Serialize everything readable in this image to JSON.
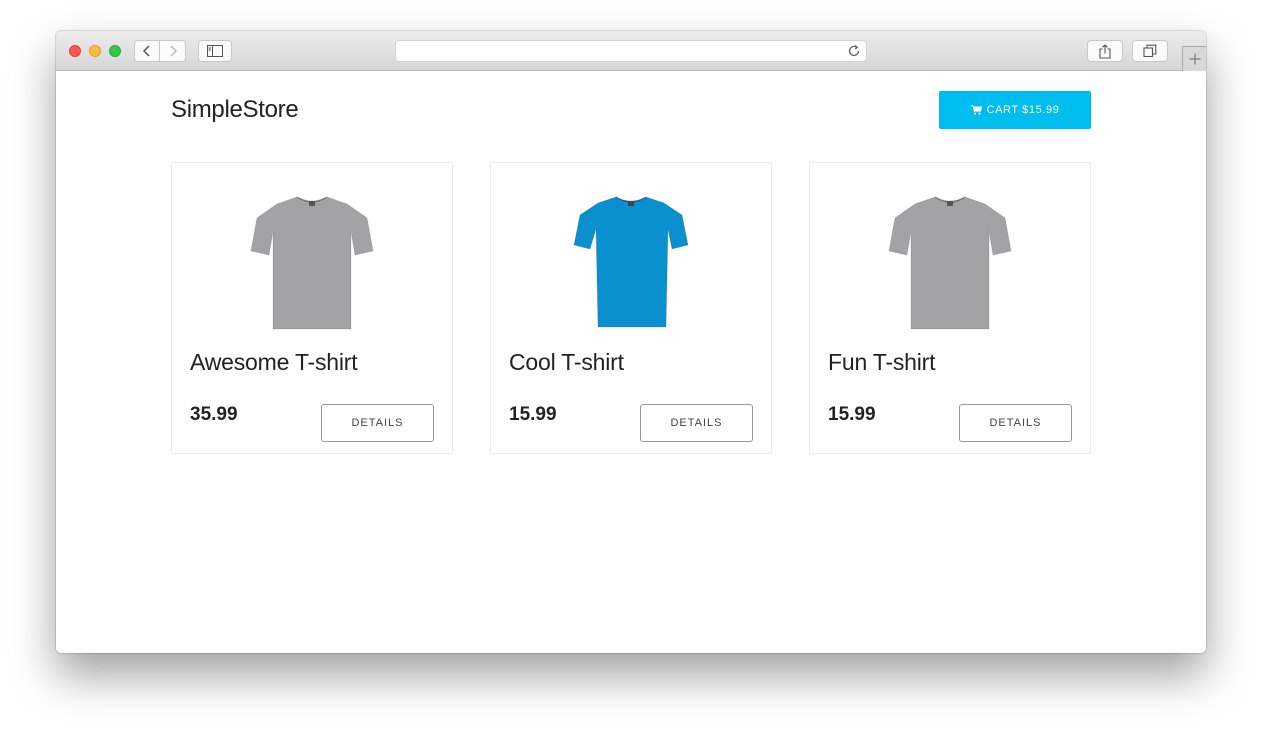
{
  "browser": {
    "address": ""
  },
  "store": {
    "brand": "SimpleStore",
    "cart": {
      "label": "CART $15.99"
    }
  },
  "products": [
    {
      "name": "Awesome T-shirt",
      "price": "35.99",
      "details_label": "DETAILS",
      "shirt_color": "#a3a3a5"
    },
    {
      "name": "Cool T-shirt",
      "price": "15.99",
      "details_label": "DETAILS",
      "shirt_color": "#0a90cf"
    },
    {
      "name": "Fun T-shirt",
      "price": "15.99",
      "details_label": "DETAILS",
      "shirt_color": "#a3a3a5"
    }
  ],
  "colors": {
    "accent": "#00bdf0"
  },
  "icons": {
    "cart": "shopping-cart-icon",
    "reload": "reload-icon",
    "share": "share-icon",
    "tabs": "tabs-icon",
    "sidebar": "sidebar-icon"
  }
}
